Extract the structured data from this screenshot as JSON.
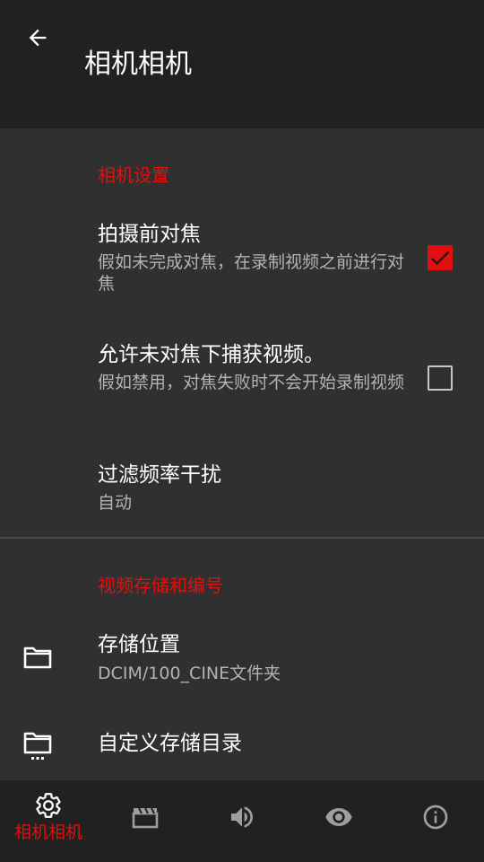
{
  "header": {
    "title": "相机相机",
    "back_icon": "arrow-left-icon"
  },
  "sections": [
    {
      "title": "相机设置",
      "items": [
        {
          "title": "拍摄前对焦",
          "summary": "假如未完成对焦，在录制视频之前进行对焦",
          "checked": true
        },
        {
          "title": "允许未对焦下捕获视频。",
          "summary": "假如禁用，对焦失败时不会开始录制视频",
          "checked": false
        },
        {
          "title": "过滤频率干扰",
          "summary": "自动"
        }
      ]
    },
    {
      "title": "视频存储和编号",
      "items": [
        {
          "title": "存储位置",
          "summary": "DCIM/100_CINE文件夹",
          "icon": "folder-icon"
        },
        {
          "title": "自定义存储目录",
          "icon": "folder-more-icon"
        }
      ]
    }
  ],
  "bottom_nav": {
    "items": [
      {
        "icon": "gear-icon",
        "label": "相机相机",
        "active": true
      },
      {
        "icon": "clapperboard-icon",
        "label": "",
        "active": false
      },
      {
        "icon": "volume-icon",
        "label": "",
        "active": false
      },
      {
        "icon": "eye-icon",
        "label": "",
        "active": false
      },
      {
        "icon": "info-icon",
        "label": "",
        "active": false
      }
    ]
  },
  "colors": {
    "accent": "#e01010",
    "header_bg": "#212121",
    "content_bg": "#303030",
    "summary_text": "#b3b3b3",
    "inactive_icon": "#9e9e9e"
  }
}
